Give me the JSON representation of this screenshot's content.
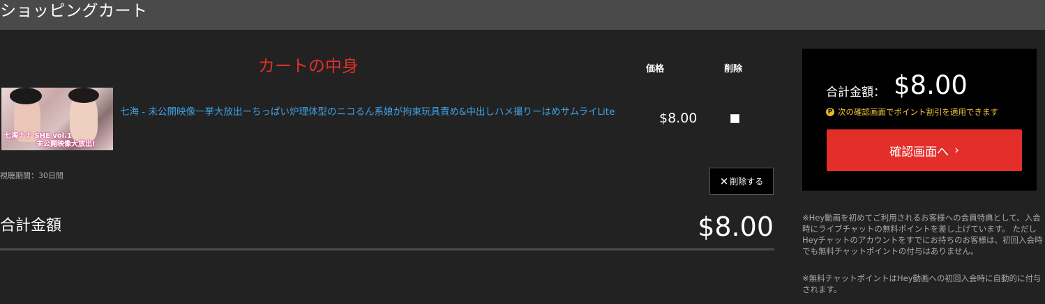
{
  "header": {
    "title": "ショッピングカート"
  },
  "cart": {
    "heading": "カートの中身",
    "columns": {
      "price": "価格",
      "delete": "削除"
    },
    "item": {
      "thumb_caption_1": "七海ナナ SHE vol.1",
      "thumb_caption_2": "未公開映像大放出!",
      "title": "七海 - 未公開映像一挙大放出ーちっぱい炉理体型のニコるん系娘が拘束玩具責め&中出しハメ撮りーはめサムライLite",
      "price": "$8.00",
      "checked": false
    },
    "period": "視聴期間：30日間",
    "delete_button": "削除する",
    "total_label": "合計金額",
    "total_value": "$8.00"
  },
  "summary": {
    "label": "合計金額：",
    "value": "$8.00",
    "points_note": "次の確認画面でポイント割引を適用できます",
    "confirm_button": "確認画面へ",
    "colors": {
      "accent": "#e32e2a",
      "point": "#f5c842"
    }
  },
  "notes": {
    "note1": "※Hey動画を初めてご利用されるお客様への会員特典として、入会時にライブチャットの無料ポイントを差し上げています。 ただしHeyチャットのアカウントをすでにお持ちのお客様は、初回入会時でも無料チャットポイントの付与はありません。",
    "note2": "※無料チャットポイントはHey動画への初回入会時に自動的に付与されます。"
  }
}
